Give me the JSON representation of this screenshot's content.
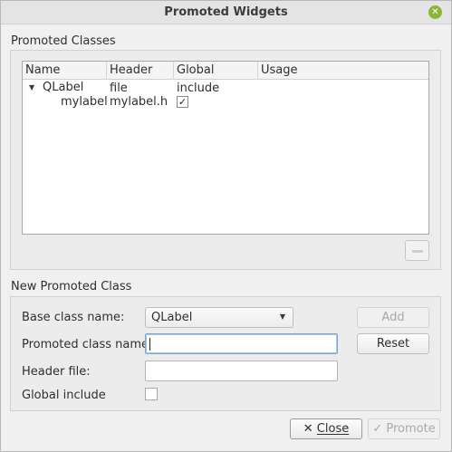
{
  "window": {
    "title": "Promoted Widgets",
    "close_icon": "close-icon"
  },
  "promoted_classes": {
    "section_title": "Promoted Classes",
    "columns": [
      "Name",
      "Header file",
      "Global include",
      "Usage"
    ],
    "rows": [
      {
        "name": "QLabel",
        "expanded": true,
        "children": [
          {
            "name": "mylabel",
            "header_file": "mylabel.h",
            "global_include": true,
            "usage": ""
          }
        ]
      }
    ],
    "remove_button_icon": "minus-icon"
  },
  "new_promoted_class": {
    "section_title": "New Promoted Class",
    "base_class_label": "Base class name:",
    "base_class_value": "QLabel",
    "promoted_class_label": "Promoted class name:",
    "promoted_class_value": "",
    "header_file_label": "Header file:",
    "header_file_value": "",
    "global_include_label": "Global include",
    "global_include_checked": false,
    "add_label": "Add",
    "reset_label": "Reset"
  },
  "footer": {
    "close_label": "Close",
    "promote_label": "Promote"
  },
  "colors": {
    "accent": "#8fb43a",
    "focus_border": "#7ea4d3"
  }
}
